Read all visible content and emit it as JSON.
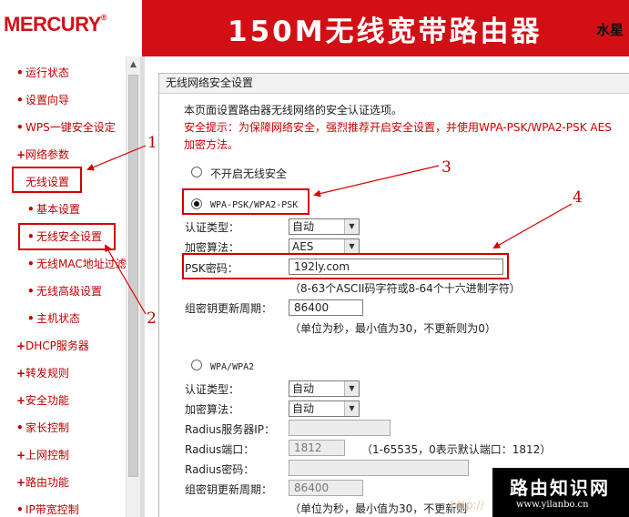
{
  "header": {
    "logo": "MERCURY",
    "logo_mark": "®",
    "title": "150M无线宽带路由器",
    "right_text": "水星"
  },
  "nav": {
    "items": [
      {
        "bullet": "•",
        "label": "运行状态"
      },
      {
        "bullet": "•",
        "label": "设置向导"
      },
      {
        "bullet": "•",
        "label": "WPS一键安全设定"
      },
      {
        "bullet": "+",
        "label": "网络参数"
      },
      {
        "bullet": "",
        "label": "无线设置"
      },
      {
        "bullet": "•",
        "label": "基本设置"
      },
      {
        "bullet": "•",
        "label": "无线安全设置"
      },
      {
        "bullet": "•",
        "label": "无线MAC地址过滤"
      },
      {
        "bullet": "•",
        "label": "无线高级设置"
      },
      {
        "bullet": "•",
        "label": "主机状态"
      },
      {
        "bullet": "+",
        "label": "DHCP服务器"
      },
      {
        "bullet": "+",
        "label": "转发规则"
      },
      {
        "bullet": "+",
        "label": "安全功能"
      },
      {
        "bullet": "•",
        "label": "家长控制"
      },
      {
        "bullet": "+",
        "label": "上网控制"
      },
      {
        "bullet": "+",
        "label": "路由功能"
      },
      {
        "bullet": "•",
        "label": "IP带宽控制"
      }
    ]
  },
  "scrollbar": {
    "up_arrow": "▲"
  },
  "panel": {
    "title": "无线网络安全设置",
    "intro": "本页面设置路由器无线网络的安全认证选项。",
    "tip_line1": "安全提示：为保障网络安全，强烈推荐开启安全设置，并使用WPA-PSK/WPA2-PSK AES",
    "tip_line2": "加密方法。",
    "opt_none": "不开启无线安全",
    "opt_psk": "WPA-PSK/WPA2-PSK",
    "psk": {
      "auth_label": "认证类型：",
      "auth_value": "自动",
      "enc_label": "加密算法：",
      "enc_value": "AES",
      "pwd_label": "PSK密码：",
      "pwd_value": "192ly.com",
      "pwd_hint": "（8-63个ASCII码字符或8-64个十六进制字符）",
      "period_label": "组密钥更新周期：",
      "period_value": "86400",
      "period_hint": "（单位为秒，最小值为30，不更新则为0）"
    },
    "opt_wpa": "WPA/WPA2",
    "wpa": {
      "auth_label": "认证类型：",
      "auth_value": "自动",
      "enc_label": "加密算法：",
      "enc_value": "自动",
      "radius_ip_label": "Radius服务器IP：",
      "radius_ip_value": "",
      "radius_port_label": "Radius端口：",
      "radius_port_value": "1812",
      "radius_port_hint": "（1-65535，0表示默认端口：1812）",
      "radius_pwd_label": "Radius密码：",
      "radius_pwd_value": "",
      "period_label": "组密钥更新周期：",
      "period_value": "86400",
      "period_hint": "（单位为秒，最小值为30，不更新则"
    }
  },
  "annotations": {
    "n1": "1",
    "n2": "2",
    "n3": "3",
    "n4": "4"
  },
  "watermark": {
    "title": "路由知识网",
    "url": "www.yilanbo.cn",
    "faint_url": "http://"
  },
  "colors": {
    "brand_red": "#d30f16",
    "highlight_red": "#d40000",
    "nav_red": "#c00000"
  }
}
